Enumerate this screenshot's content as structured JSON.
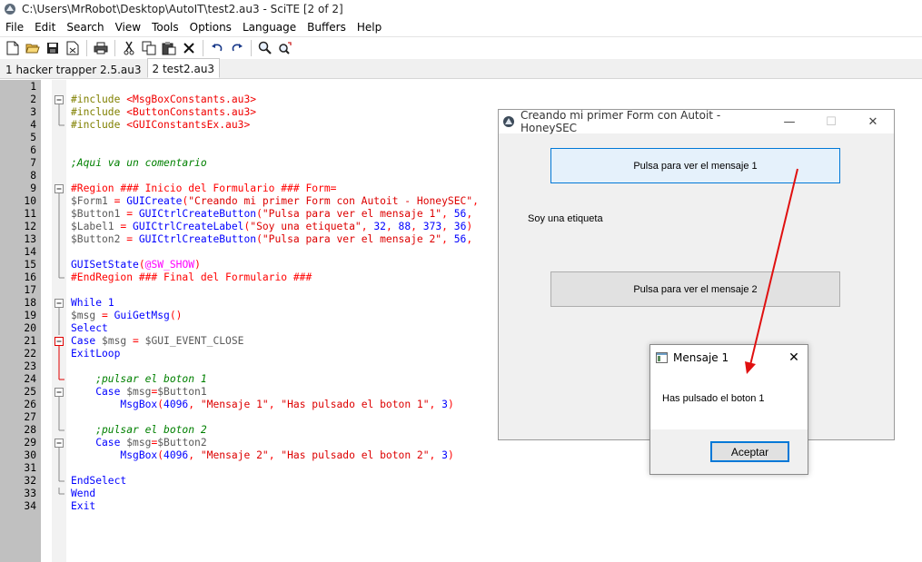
{
  "window": {
    "title": "C:\\Users\\MrRobot\\Desktop\\AutoIT\\test2.au3 - SciTE [2 of 2]"
  },
  "menu": [
    "File",
    "Edit",
    "Search",
    "View",
    "Tools",
    "Options",
    "Language",
    "Buffers",
    "Help"
  ],
  "toolbar_icons": [
    "new-file-icon",
    "open-folder-icon",
    "save-icon",
    "close-file-icon",
    "print-icon",
    "cut-icon",
    "copy-icon",
    "paste-icon",
    "delete-icon",
    "undo-icon",
    "redo-icon",
    "find-icon",
    "replace-icon"
  ],
  "tabs": [
    {
      "label": "1 hacker trapper 2.5.au3",
      "active": false
    },
    {
      "label": "2 test2.au3",
      "active": true
    }
  ],
  "code": [
    {
      "n": "1",
      "fold": "",
      "tokens": []
    },
    {
      "n": "2",
      "fold": "box",
      "tokens": [
        [
          "pp",
          "#include "
        ],
        [
          "inc",
          "<MsgBoxConstants.au3>"
        ]
      ]
    },
    {
      "n": "3",
      "fold": "line",
      "tokens": [
        [
          "pp",
          "#include "
        ],
        [
          "inc",
          "<ButtonConstants.au3>"
        ]
      ]
    },
    {
      "n": "4",
      "fold": "end",
      "tokens": [
        [
          "pp",
          "#include "
        ],
        [
          "inc",
          "<GUIConstantsEx.au3>"
        ]
      ]
    },
    {
      "n": "5",
      "fold": "",
      "tokens": []
    },
    {
      "n": "6",
      "fold": "",
      "tokens": []
    },
    {
      "n": "7",
      "fold": "",
      "tokens": [
        [
          "com",
          ";Aqui va un comentario"
        ]
      ]
    },
    {
      "n": "8",
      "fold": "",
      "tokens": []
    },
    {
      "n": "9",
      "fold": "box",
      "tokens": [
        [
          "reg",
          "#Region ### Inicio del Formulario ### Form="
        ]
      ]
    },
    {
      "n": "10",
      "fold": "line",
      "tokens": [
        [
          "var",
          "$Form1 "
        ],
        [
          "op",
          "= "
        ],
        [
          "fn",
          "GUICreate"
        ],
        [
          "op",
          "("
        ],
        [
          "str",
          "\"Creando mi primer Form con Autoit - HoneySEC\""
        ],
        [
          "op",
          ","
        ]
      ]
    },
    {
      "n": "11",
      "fold": "line",
      "tokens": [
        [
          "var",
          "$Button1 "
        ],
        [
          "op",
          "= "
        ],
        [
          "fn",
          "GUICtrlCreateButton"
        ],
        [
          "op",
          "("
        ],
        [
          "str",
          "\"Pulsa para ver el mensaje 1\""
        ],
        [
          "op",
          ", "
        ],
        [
          "num",
          "56"
        ],
        [
          "op",
          ","
        ]
      ]
    },
    {
      "n": "12",
      "fold": "line",
      "tokens": [
        [
          "var",
          "$Label1 "
        ],
        [
          "op",
          "= "
        ],
        [
          "fn",
          "GUICtrlCreateLabel"
        ],
        [
          "op",
          "("
        ],
        [
          "str",
          "\"Soy una etiqueta\""
        ],
        [
          "op",
          ", "
        ],
        [
          "num",
          "32"
        ],
        [
          "op",
          ", "
        ],
        [
          "num",
          "88"
        ],
        [
          "op",
          ", "
        ],
        [
          "num",
          "373"
        ],
        [
          "op",
          ", "
        ],
        [
          "num",
          "36"
        ],
        [
          "op",
          ")"
        ]
      ]
    },
    {
      "n": "13",
      "fold": "line",
      "tokens": [
        [
          "var",
          "$Button2 "
        ],
        [
          "op",
          "= "
        ],
        [
          "fn",
          "GUICtrlCreateButton"
        ],
        [
          "op",
          "("
        ],
        [
          "str",
          "\"Pulsa para ver el mensaje 2\""
        ],
        [
          "op",
          ", "
        ],
        [
          "num",
          "56"
        ],
        [
          "op",
          ","
        ]
      ]
    },
    {
      "n": "14",
      "fold": "line",
      "tokens": []
    },
    {
      "n": "15",
      "fold": "line",
      "tokens": [
        [
          "fn",
          "GUISetState"
        ],
        [
          "op",
          "("
        ],
        [
          "macro",
          "@SW_SHOW"
        ],
        [
          "op",
          ")"
        ]
      ]
    },
    {
      "n": "16",
      "fold": "end",
      "tokens": [
        [
          "reg",
          "#EndRegion ### Final del Formulario ###"
        ]
      ]
    },
    {
      "n": "17",
      "fold": "",
      "tokens": []
    },
    {
      "n": "18",
      "fold": "box",
      "tokens": [
        [
          "kw",
          "While "
        ],
        [
          "num",
          "1"
        ]
      ]
    },
    {
      "n": "19",
      "fold": "line",
      "tokens": [
        [
          "var",
          "$msg "
        ],
        [
          "op",
          "= "
        ],
        [
          "fn",
          "GuiGetMsg"
        ],
        [
          "op",
          "()"
        ]
      ]
    },
    {
      "n": "20",
      "fold": "line",
      "tokens": [
        [
          "kw",
          "Select"
        ]
      ]
    },
    {
      "n": "21",
      "fold": "redbox",
      "tokens": [
        [
          "kw",
          "Case "
        ],
        [
          "var",
          "$msg "
        ],
        [
          "op",
          "= "
        ],
        [
          "var",
          "$GUI_EVENT_CLOSE"
        ]
      ]
    },
    {
      "n": "22",
      "fold": "redline",
      "tokens": [
        [
          "kw",
          "ExitLoop"
        ]
      ]
    },
    {
      "n": "23",
      "fold": "redline",
      "tokens": []
    },
    {
      "n": "24",
      "fold": "redend",
      "tokens": [
        [
          "com",
          "    ;pulsar el boton 1"
        ]
      ]
    },
    {
      "n": "25",
      "fold": "box",
      "tokens": [
        [
          "kw",
          "    Case "
        ],
        [
          "var",
          "$msg"
        ],
        [
          "op",
          "="
        ],
        [
          "var",
          "$Button1"
        ]
      ]
    },
    {
      "n": "26",
      "fold": "line",
      "tokens": [
        [
          "fn",
          "        MsgBox"
        ],
        [
          "op",
          "("
        ],
        [
          "num",
          "4096"
        ],
        [
          "op",
          ", "
        ],
        [
          "str",
          "\"Mensaje 1\""
        ],
        [
          "op",
          ", "
        ],
        [
          "str",
          "\"Has pulsado el boton 1\""
        ],
        [
          "op",
          ", "
        ],
        [
          "num",
          "3"
        ],
        [
          "op",
          ")"
        ]
      ]
    },
    {
      "n": "27",
      "fold": "line",
      "tokens": []
    },
    {
      "n": "28",
      "fold": "end",
      "tokens": [
        [
          "com",
          "    ;pulsar el boton 2"
        ]
      ]
    },
    {
      "n": "29",
      "fold": "box",
      "tokens": [
        [
          "kw",
          "    Case "
        ],
        [
          "var",
          "$msg"
        ],
        [
          "op",
          "="
        ],
        [
          "var",
          "$Button2"
        ]
      ]
    },
    {
      "n": "30",
      "fold": "line",
      "tokens": [
        [
          "fn",
          "        MsgBox"
        ],
        [
          "op",
          "("
        ],
        [
          "num",
          "4096"
        ],
        [
          "op",
          ", "
        ],
        [
          "str",
          "\"Mensaje 2\""
        ],
        [
          "op",
          ", "
        ],
        [
          "str",
          "\"Has pulsado el boton 2\""
        ],
        [
          "op",
          ", "
        ],
        [
          "num",
          "3"
        ],
        [
          "op",
          ")"
        ]
      ]
    },
    {
      "n": "31",
      "fold": "line",
      "tokens": []
    },
    {
      "n": "32",
      "fold": "end",
      "tokens": [
        [
          "kw",
          "EndSelect"
        ]
      ]
    },
    {
      "n": "33",
      "fold": "end",
      "tokens": [
        [
          "kw",
          "Wend"
        ]
      ]
    },
    {
      "n": "34",
      "fold": "",
      "tokens": [
        [
          "kw",
          "Exit"
        ]
      ]
    }
  ],
  "form": {
    "title": "Creando mi primer Form con Autoit - HoneySEC",
    "button1": "Pulsa para ver el mensaje 1",
    "label": "Soy una etiqueta",
    "button2": "Pulsa para ver el mensaje 2"
  },
  "msgbox": {
    "title": "Mensaje 1",
    "text": "Has pulsado el boton 1",
    "ok": "Aceptar"
  },
  "colors": {
    "arrow": "#e01010",
    "accent": "#0078d7"
  }
}
